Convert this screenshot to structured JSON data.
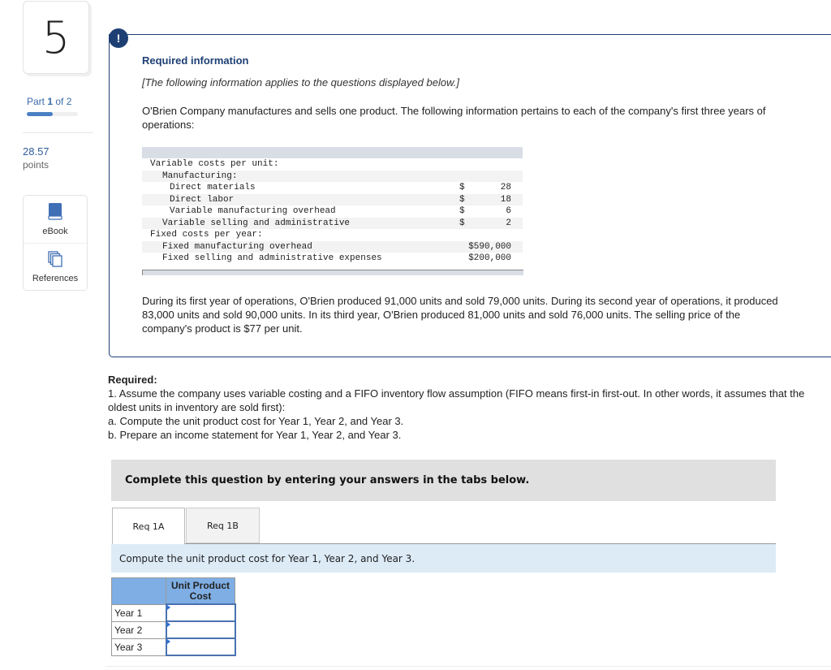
{
  "question": {
    "number": "5",
    "part_prefix": "Part ",
    "part_current": "1",
    "part_suffix": " of 2",
    "progress_fraction": 0.5,
    "points_value": "28.57",
    "points_label": "points"
  },
  "tools": [
    {
      "label": "eBook",
      "icon": "book-icon"
    },
    {
      "label": "References",
      "icon": "references-icon"
    }
  ],
  "info": {
    "alert_symbol": "!",
    "title": "Required information",
    "note": "[The following information applies to the questions displayed below.]",
    "intro": "O'Brien Company manufactures and sells one product. The following information pertains to each of the company's first three years of operations:",
    "table": [
      {
        "label": "Variable costs per unit:",
        "indent": 0,
        "currency": "",
        "value": ""
      },
      {
        "label": "Manufacturing:",
        "indent": 1,
        "currency": "",
        "value": ""
      },
      {
        "label": "Direct materials",
        "indent": 2,
        "currency": "$",
        "value": "28"
      },
      {
        "label": "Direct labor",
        "indent": 2,
        "currency": "$",
        "value": "18"
      },
      {
        "label": "Variable manufacturing overhead",
        "indent": 2,
        "currency": "$",
        "value": "6"
      },
      {
        "label": "Variable selling and administrative",
        "indent": 1,
        "currency": "$",
        "value": "2"
      },
      {
        "label": "Fixed costs per year:",
        "indent": 0,
        "currency": "",
        "value": ""
      },
      {
        "label": "Fixed manufacturing overhead",
        "indent": 1,
        "currency": "",
        "value": "$590,000"
      },
      {
        "label": "Fixed selling and administrative expenses",
        "indent": 1,
        "currency": "",
        "value": "$200,000"
      }
    ],
    "narrative": "During its first year of operations, O'Brien produced 91,000 units and sold 79,000 units. During its second year of operations, it produced 83,000 units and sold 90,000 units. In its third year, O'Brien produced 81,000 units and sold 76,000 units. The selling price of the company's product is $77 per unit."
  },
  "required": {
    "heading": "Required:",
    "line1": "1. Assume the company uses variable costing and a FIFO inventory flow assumption (FIFO means first-in first-out. In other words, it assumes that the oldest units in inventory are sold first):",
    "line_a": "a. Compute the unit product cost for Year 1, Year 2, and Year 3.",
    "line_b": "b. Prepare an income statement for Year 1, Year 2, and Year 3."
  },
  "complete_banner": "Complete this question by entering your answers in the tabs below.",
  "tabs": [
    {
      "label": "Req 1A",
      "active": true
    },
    {
      "label": "Req 1B",
      "active": false
    }
  ],
  "instruction": "Compute the unit product cost for Year 1, Year 2, and Year 3.",
  "answer_table": {
    "column_header": "Unit Product Cost",
    "rows": [
      {
        "label": "Year 1",
        "value": ""
      },
      {
        "label": "Year 2",
        "value": ""
      },
      {
        "label": "Year 3",
        "value": ""
      }
    ]
  }
}
